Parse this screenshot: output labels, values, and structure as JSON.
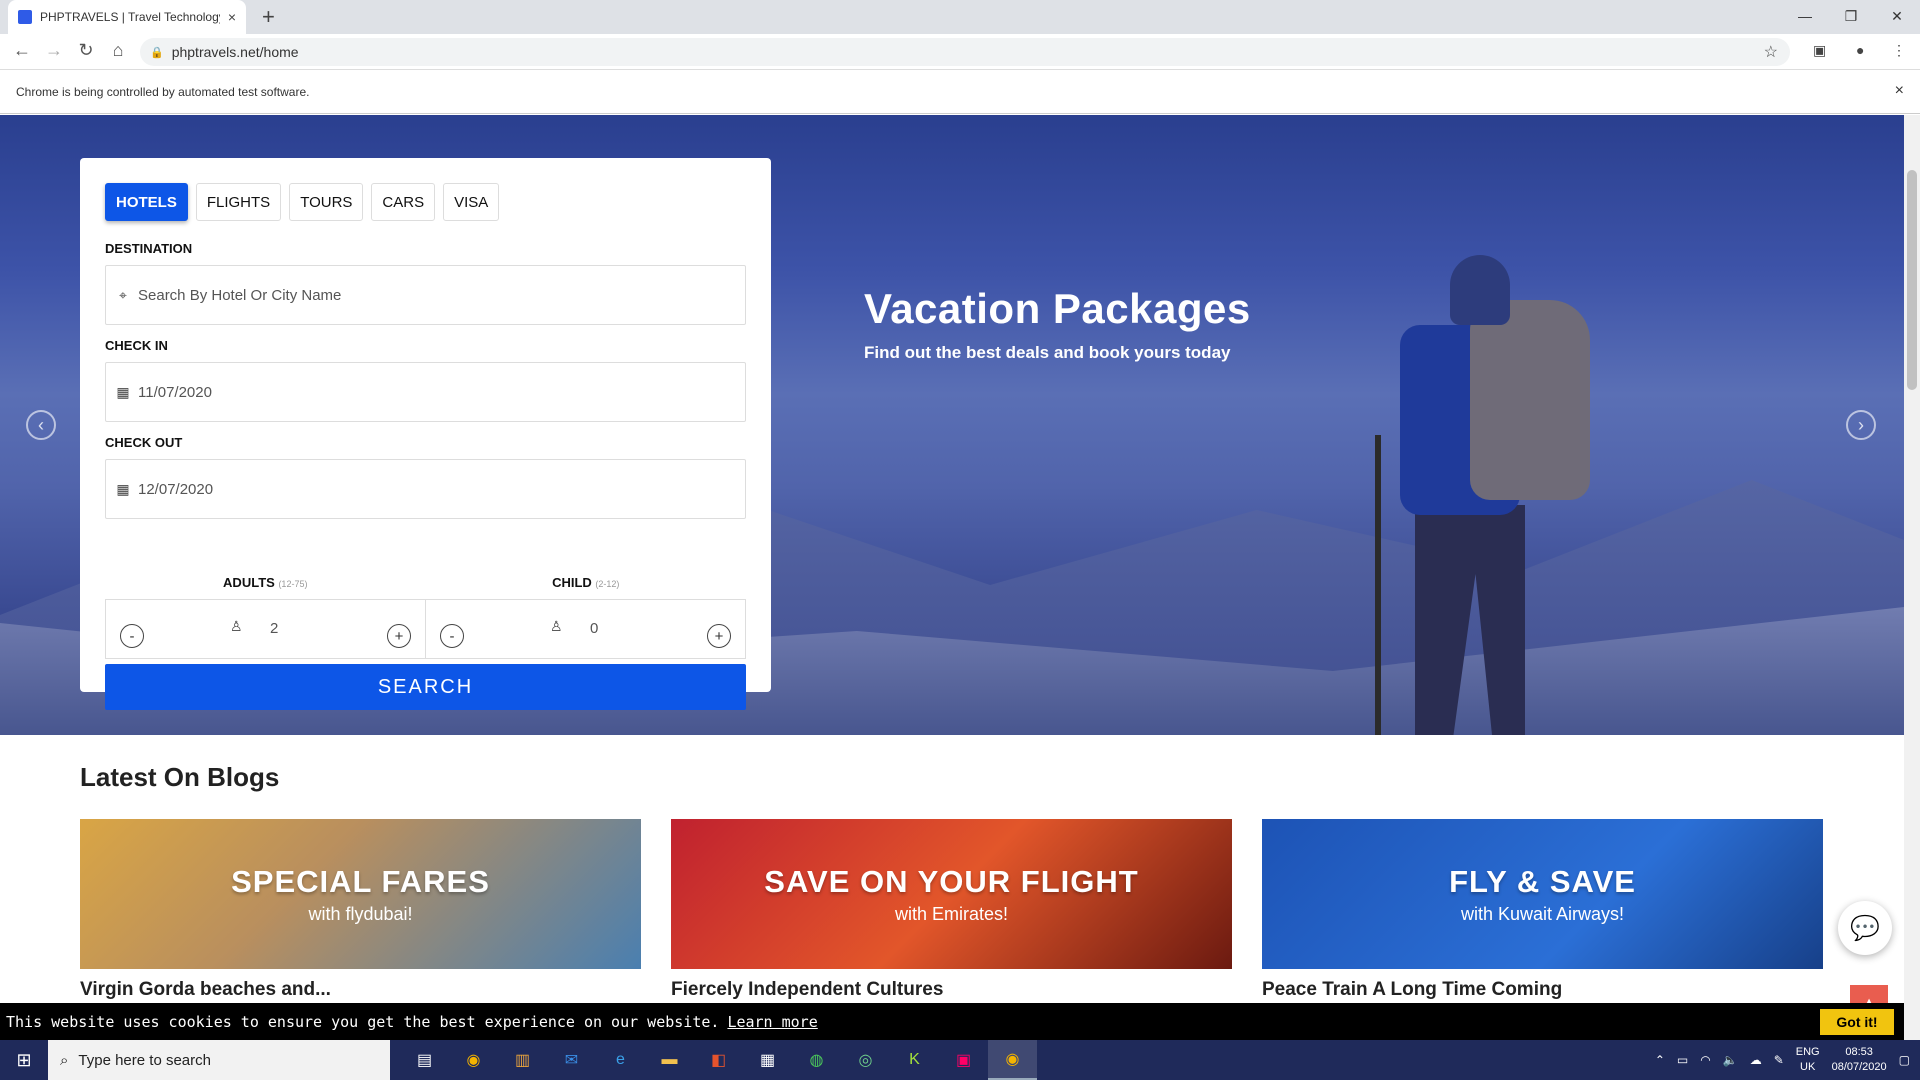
{
  "browser": {
    "tab_title": "PHPTRAVELS | Travel Technology",
    "tab_close": "×",
    "new_tab": "+",
    "url": "phptravels.net/home",
    "automation_notice": "Chrome is being controlled by automated test software.",
    "notice_close": "×",
    "win_min": "—",
    "win_restore": "❐",
    "win_close": "✕"
  },
  "search": {
    "tabs": [
      "HOTELS",
      "FLIGHTS",
      "TOURS",
      "CARS",
      "VISA"
    ],
    "active_tab": "HOTELS",
    "destination_label": "DESTINATION",
    "destination_placeholder": "Search By Hotel Or City Name",
    "checkin_label": "CHECK IN",
    "checkin_value": "11/07/2020",
    "checkout_label": "CHECK OUT",
    "checkout_value": "12/07/2020",
    "adults_label": "ADULTS",
    "adults_range": "(12-75)",
    "adults_value": "2",
    "child_label": "CHILD",
    "child_range": "(2-12)",
    "child_value": "0",
    "minus": "-",
    "plus": "+",
    "button": "SEARCH"
  },
  "hero": {
    "title": "Vacation Packages",
    "subtitle": "Find out the best deals and book yours today",
    "prev": "‹",
    "next": "›"
  },
  "blogs": {
    "title": "Latest On Blogs",
    "items": [
      {
        "banner_title": "SPECIAL FARES",
        "banner_sub": "with flydubai!",
        "caption": "Virgin Gorda beaches and..."
      },
      {
        "banner_title": "SAVE ON YOUR FLIGHT",
        "banner_sub": "with Emirates!",
        "caption": "Fiercely Independent Cultures"
      },
      {
        "banner_title": "FLY & SAVE",
        "banner_sub": "with Kuwait Airways!",
        "caption": "Peace Train A Long Time Coming"
      }
    ]
  },
  "cookie": {
    "text": "This website uses cookies to ensure you get the best experience on our website.",
    "link": "Learn more",
    "button": "Got it!"
  },
  "taskbar": {
    "search_placeholder": "Type here to search",
    "lang_top": "ENG",
    "lang_bottom": "UK",
    "time": "08:53",
    "date": "08/07/2020"
  },
  "colors": {
    "accent": "#0d56e7",
    "hero_overlay": "#3d53a8",
    "cookie_button": "#f1c40f",
    "to_top": "#e74c3c"
  }
}
